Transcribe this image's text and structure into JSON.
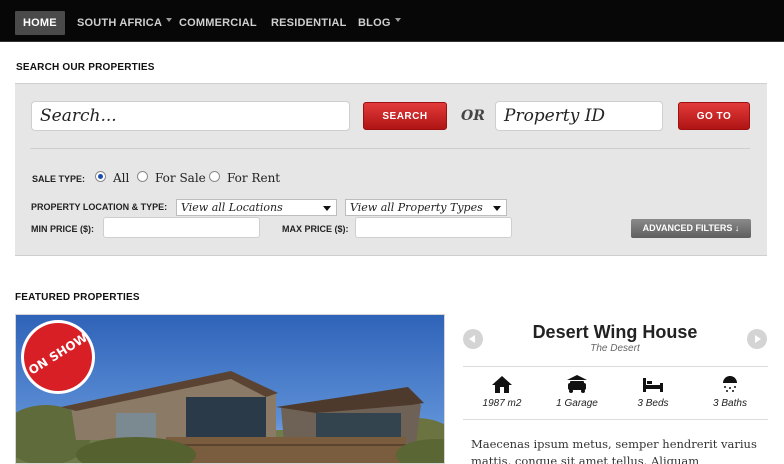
{
  "nav": {
    "items": [
      {
        "label": "HOME",
        "active": true,
        "has_caret": false
      },
      {
        "label": "SOUTH AFRICA",
        "active": false,
        "has_caret": true
      },
      {
        "label": "COMMERCIAL",
        "active": false,
        "has_caret": false
      },
      {
        "label": "RESIDENTIAL",
        "active": false,
        "has_caret": false
      },
      {
        "label": "BLOG",
        "active": false,
        "has_caret": true
      }
    ]
  },
  "search": {
    "section_title": "SEARCH OUR PROPERTIES",
    "search_value": "Search...",
    "search_button": "SEARCH",
    "or_label": "OR",
    "property_id_value": "Property ID",
    "goto_button": "GO TO",
    "sale_type_label": "SALE TYPE:",
    "sale_options": [
      {
        "label": "All",
        "checked": true
      },
      {
        "label": "For Sale",
        "checked": false
      },
      {
        "label": "For Rent",
        "checked": false
      }
    ],
    "location_type_label": "PROPERTY LOCATION & TYPE:",
    "location_select": "View all Locations",
    "type_select": "View all Property Types",
    "min_price_label": "MIN PRICE ($):",
    "max_price_label": "MAX PRICE ($):",
    "advanced_filters": "ADVANCED FILTERS ↓"
  },
  "featured": {
    "section_title": "FEATURED PROPERTIES",
    "badge": "ON SHOW",
    "title": "Desert Wing House",
    "subtitle": "The Desert",
    "features": [
      {
        "icon": "house-icon",
        "label": "1987 m2"
      },
      {
        "icon": "car-icon",
        "label": "1 Garage"
      },
      {
        "icon": "bed-icon",
        "label": "3 Beds"
      },
      {
        "icon": "shower-icon",
        "label": "3 Baths"
      }
    ],
    "description": "Maecenas ipsum metus, semper hendrerit varius mattis, congue sit amet tellus. Aliquam"
  },
  "colors": {
    "nav_bg": "#070707",
    "accent_red": "#c81e1e",
    "panel_bg": "#e6e6e6",
    "radio_checked": "#1a4fb0"
  }
}
